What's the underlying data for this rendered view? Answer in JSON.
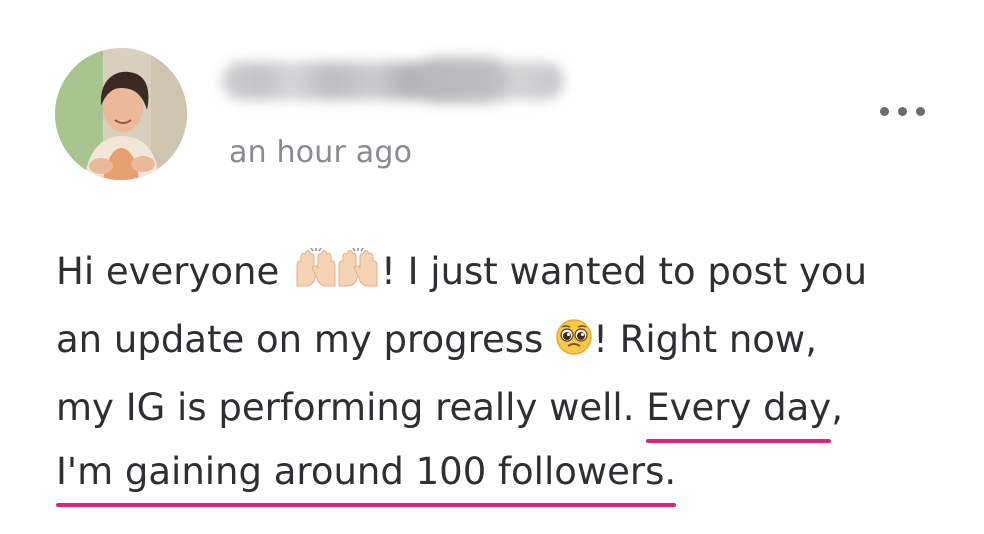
{
  "post": {
    "timestamp": "an hour ago",
    "more_icon": "more-horizontal-icon",
    "body_lines": [
      {
        "text_a": "Hi everyone ",
        "emoji": "raising-hands-emoji",
        "text_b": "! I just wanted to post you"
      },
      {
        "text_a": "an update on my progress ",
        "emoji": "pleading-face-emoji",
        "text_b": "! Right now,"
      },
      {
        "text_a": "my IG is performing really well. ",
        "highlight": "Every day",
        "text_b": ","
      },
      {
        "highlight": "I'm gaining around 100 followers."
      }
    ],
    "highlight_color": "#e2237e",
    "text_color": "#2f2f33",
    "meta_color": "#8a8a90"
  }
}
